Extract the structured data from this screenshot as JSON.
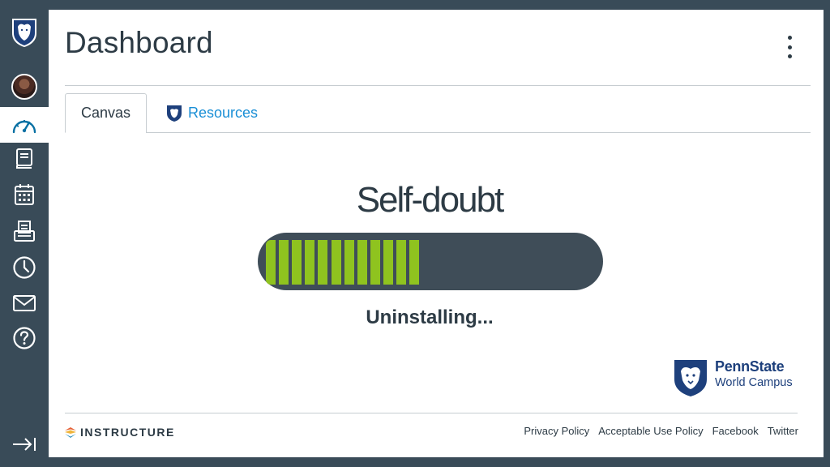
{
  "nav": {
    "items": [
      {
        "name": "institution-logo",
        "icon": "penn-state-shield-icon"
      },
      {
        "name": "account",
        "icon": "avatar"
      },
      {
        "name": "dashboard",
        "icon": "dashboard-icon",
        "active": true
      },
      {
        "name": "courses",
        "icon": "courses-icon"
      },
      {
        "name": "calendar",
        "icon": "calendar-icon"
      },
      {
        "name": "inbox-notes",
        "icon": "printer-icon"
      },
      {
        "name": "history",
        "icon": "clock-icon"
      },
      {
        "name": "inbox",
        "icon": "envelope-icon"
      },
      {
        "name": "help",
        "icon": "help-icon"
      },
      {
        "name": "collapse",
        "icon": "collapse-arrow-icon"
      }
    ]
  },
  "header": {
    "title": "Dashboard",
    "options_icon": "kebab-menu-icon"
  },
  "tabs": [
    {
      "label": "Canvas",
      "selected": true
    },
    {
      "label": "Resources",
      "selected": false,
      "icon": "penn-state-shield-icon"
    }
  ],
  "meme": {
    "headline": "Self-doubt",
    "progress_fraction": 0.45,
    "progress_segments": 12,
    "status": "Uninstalling..."
  },
  "branding": {
    "name": "PennState",
    "campus": "World Campus"
  },
  "footer": {
    "brand": "INSTRUCTURE",
    "links": [
      "Privacy Policy",
      "Acceptable Use Policy",
      "Facebook",
      "Twitter"
    ]
  },
  "colors": {
    "nav_bg": "#394b58",
    "accent_blue": "#0770a3",
    "progress_fill": "#8fc31f",
    "progress_track": "#3f4d58",
    "penn_state_blue": "#1e407c"
  }
}
